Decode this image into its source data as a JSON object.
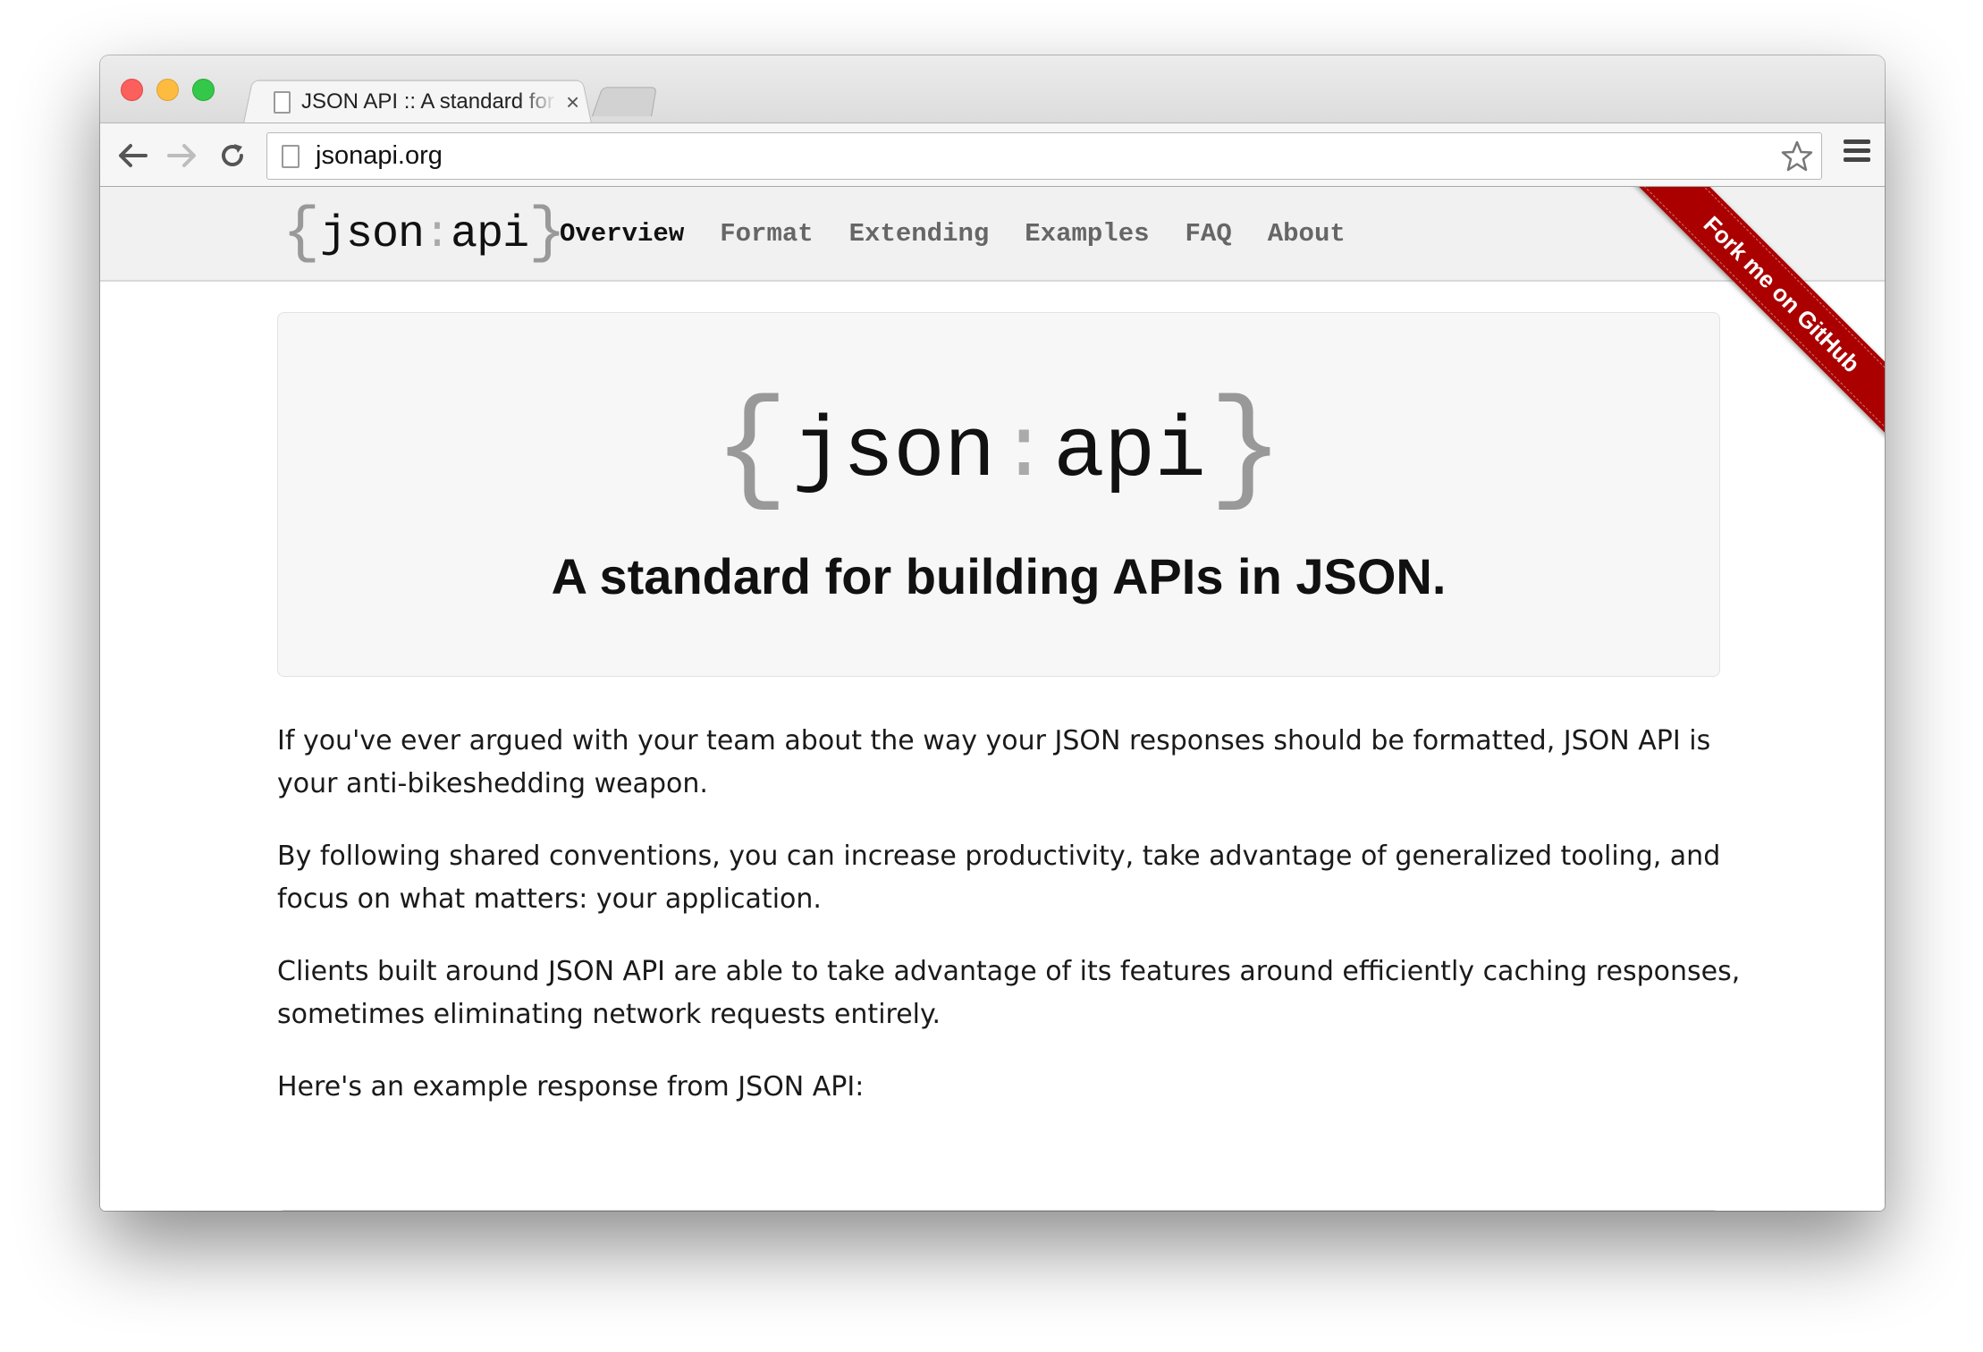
{
  "browser": {
    "tab_title": "JSON API :: A standard for building APIs in JSON.",
    "tab_close": "×",
    "url": "jsonapi.org",
    "icons": [
      "back-arrow-icon",
      "forward-arrow-icon",
      "reload-icon",
      "page-icon",
      "star-icon",
      "menu-icon"
    ]
  },
  "site": {
    "logo": {
      "open": "{",
      "left": "json",
      "colon": ":",
      "right": "api",
      "close": "}"
    },
    "nav": [
      {
        "label": "Overview",
        "active": true
      },
      {
        "label": "Format",
        "active": false
      },
      {
        "label": "Extending",
        "active": false
      },
      {
        "label": "Examples",
        "active": false
      },
      {
        "label": "FAQ",
        "active": false
      },
      {
        "label": "About",
        "active": false
      }
    ],
    "ribbon": "Fork me on GitHub",
    "ribbon_color": "#aa0000",
    "tagline": "A standard for building APIs in JSON.",
    "paragraphs": [
      "If you've ever argued with your team about the way your JSON responses should be formatted, JSON API is your anti-bikeshedding weapon.",
      "By following shared conventions, you can increase productivity, take advantage of generalized tooling, and focus on what matters: your application.",
      "Clients built around JSON API are able to take advantage of its features around efficiently caching responses, sometimes eliminating network requests entirely.",
      "Here's an example response from JSON API:"
    ],
    "code_first_line": "{"
  }
}
